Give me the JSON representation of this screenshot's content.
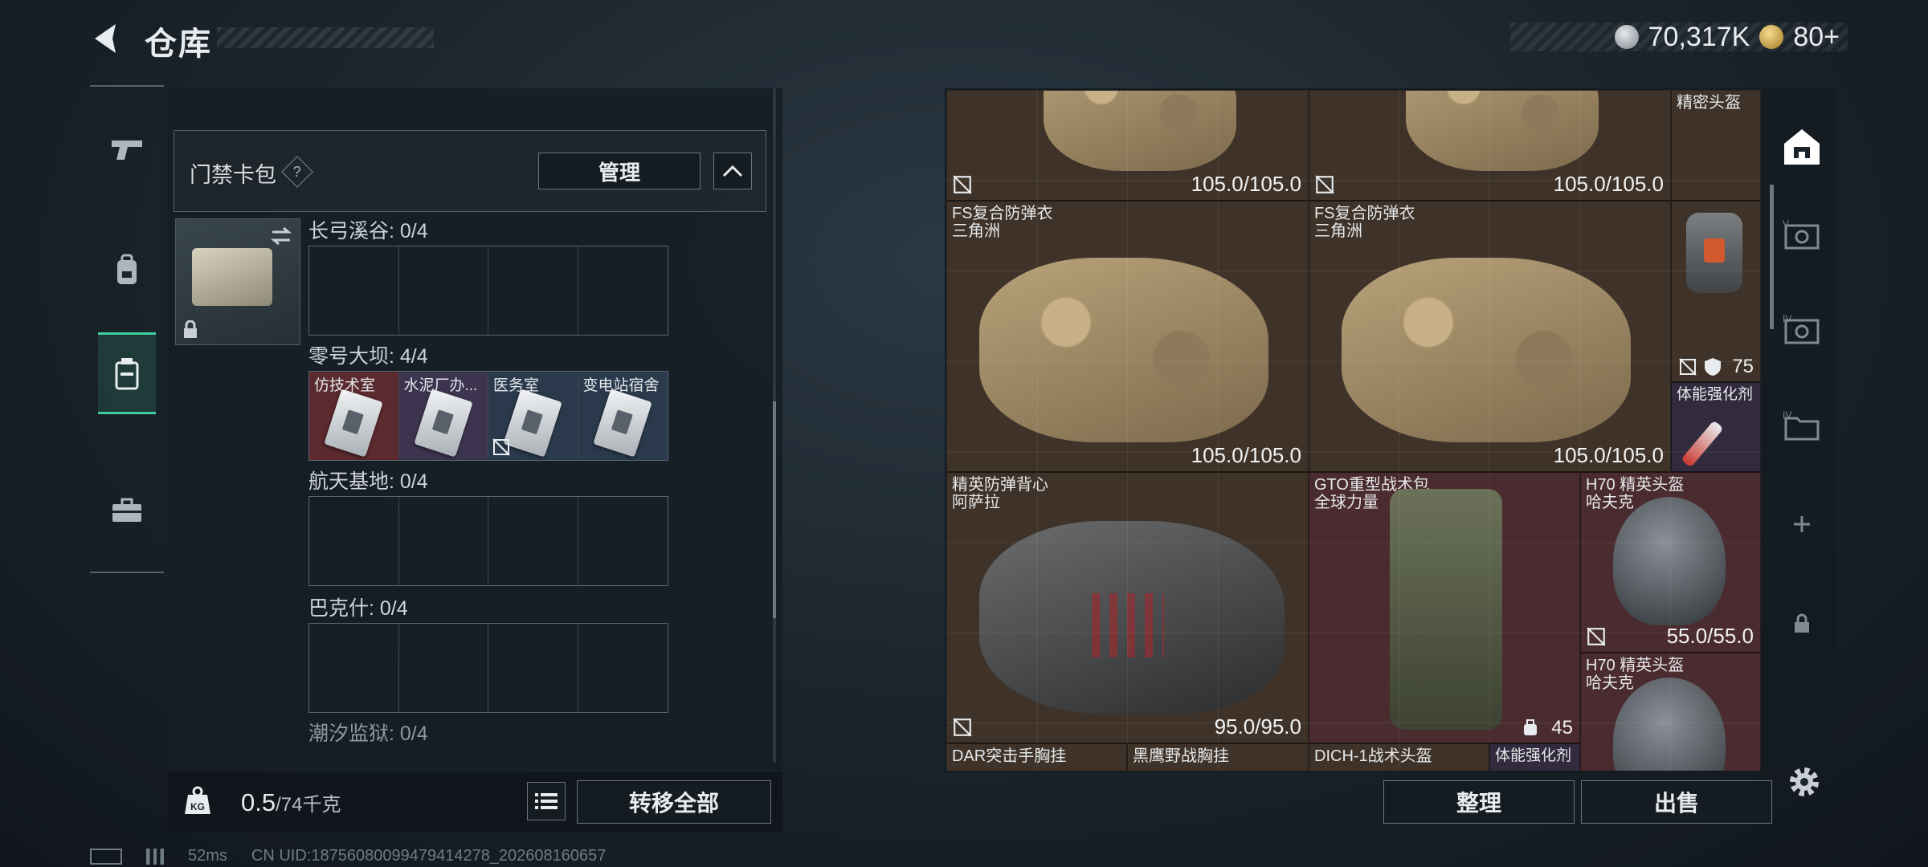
{
  "header": {
    "title": "仓库"
  },
  "currency": {
    "silver": "70,317K",
    "gold": "80+"
  },
  "cardpack": {
    "title": "门禁卡包",
    "help": "?",
    "manage_label": "管理",
    "zones": [
      {
        "label": "长弓溪谷: 0/4",
        "cards": []
      },
      {
        "label": "零号大坝: 4/4",
        "cards": [
          "仿技术室",
          "水泥厂办...",
          "医务室",
          "变电站宿舍"
        ]
      },
      {
        "label": "航天基地: 0/4",
        "cards": []
      },
      {
        "label": "巴克什: 0/4",
        "cards": []
      },
      {
        "label": "潮汐监狱: 0/4",
        "cards": []
      }
    ]
  },
  "weight": {
    "current": "0.5",
    "max": "/74千克"
  },
  "actions": {
    "transfer_all": "转移全部",
    "sort": "整理",
    "sell": "出售"
  },
  "stash": {
    "items": [
      {
        "name": "",
        "value": "105.0/105.0"
      },
      {
        "name": "",
        "value": "105.0/105.0"
      },
      {
        "name": "精密头盔",
        "value": ""
      },
      {
        "name": "FS复合防弹衣\n三角洲",
        "value": "105.0/105.0"
      },
      {
        "name": "FS复合防弹衣\n三角洲",
        "value": "105.0/105.0"
      },
      {
        "name": "",
        "value": "75"
      },
      {
        "name": "体能强化剂",
        "value": ""
      },
      {
        "name": "精英防弹背心\n阿萨拉",
        "value": "95.0/95.0"
      },
      {
        "name": "GTO重型战术包\n全球力量",
        "value": "45"
      },
      {
        "name": "H70 精英头盔\n哈夫克",
        "value": "55.0/55.0"
      },
      {
        "name": "H70 精英头盔\n哈夫克",
        "value": ""
      },
      {
        "name": "DAR突击手胸挂",
        "value": ""
      },
      {
        "name": "黑鹰野战胸挂",
        "value": ""
      },
      {
        "name": "DICH-1战术头盔",
        "value": ""
      },
      {
        "name": "体能强化剂",
        "value": ""
      }
    ]
  },
  "status": {
    "ping": "52ms",
    "uid": "CN UID:18756080099479414278_202608160657"
  },
  "colors": {
    "accent": "#3fcf9f",
    "tile_brown": "#3f3329",
    "tile_red": "#4a2b2f",
    "tile_purple": "#312b3d"
  }
}
